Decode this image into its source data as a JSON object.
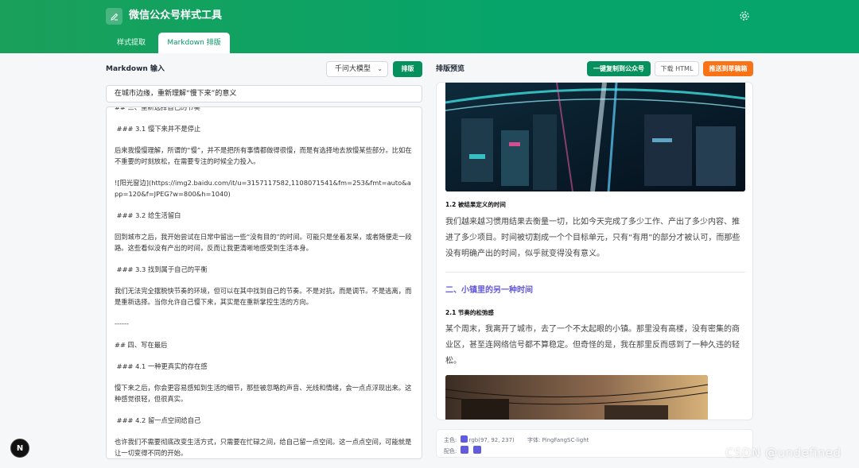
{
  "app": {
    "title": "微信公众号样式工具"
  },
  "tabs": [
    {
      "label": "样式提取",
      "active": false
    },
    {
      "label": "Markdown 排版",
      "active": true
    }
  ],
  "editor": {
    "label": "Markdown 输入",
    "model_select": "千问大模型",
    "format_button": "排版",
    "title_value": "在城市边缘，重新理解“慢下来”的意义",
    "content": "## 三、重新选择自己的节奏\n\n ### 3.1 慢下来并不是停止\n\n后来我慢慢理解，所谓的“慢”，并不是把所有事情都做得很慢，而是有选择地去放慢某些部分。比如在不重要的时刻放松，在需要专注的时候全力投入。\n\n![阳光窗边](https://img2.baidu.com/it/u=3157117582,1108071541&fm=253&fmt=auto&app=120&f=JPEG?w=800&h=1040)\n\n ### 3.2 给生活留白\n\n回到城市之后，我开始尝试在日常中留出一些“没有目的”的时间。可能只是坐着发呆，或者随便走一段路。这些看似没有产出的时间，反而让我更清晰地感受到生活本身。\n\n ### 3.3 找到属于自己的平衡\n\n我们无法完全摆脱快节奏的环境，但可以在其中找到自己的节奏。不是对抗，而是调节。不是逃离，而是重新选择。当你允许自己慢下来，其实是在重新掌控生活的方向。\n\n------\n\n## 四、写在最后\n\n ### 4.1 一种更真实的存在感\n\n慢下来之后，你会更容易感知到生活的细节，那些被忽略的声音、光线和情绪，会一点点浮现出来。这种感觉很轻，但很真实。\n\n ### 4.2 留一点空间给自己\n\n也许我们不需要彻底改变生活方式，只需要在忙碌之间，给自己留一点空间。这一点点空间，可能就是让一切变得不同的开始。"
  },
  "preview": {
    "label": "排版预览",
    "copy_button": "一键复制到公众号",
    "download_button": "下载 HTML",
    "push_button": "推送到草稿箱",
    "h3_1_2": "1.2 被结果定义的时间",
    "para_1_2": "我们越来越习惯用结果去衡量一切，比如今天完成了多少工作、产出了多少内容、推进了多少项目。时间被切割成一个个目标单元，只有“有用”的部分才被认可，而那些没有明确产出的时间，似乎就变得没有意义。",
    "h2_2": "二、小镇里的另一种时间",
    "h3_2_1": "2.1 节奏的松弛感",
    "para_2_1": "某个周末，我离开了城市，去了一个不太起眼的小镇。那里没有高楼，没有密集的商业区，甚至连网络信号都不算稳定。但奇怪的是，我在那里反而感到了一种久违的轻松。"
  },
  "footer": {
    "main_color_label": "主色:",
    "main_color_value": "rgb(97, 92, 237)",
    "font_label": "字体:",
    "font_value": "PingFangSC-light",
    "palette_label": "配色:",
    "accent_color": "#615cdf"
  },
  "fab": {
    "label": "N"
  },
  "watermark": "CSDN @undefined"
}
